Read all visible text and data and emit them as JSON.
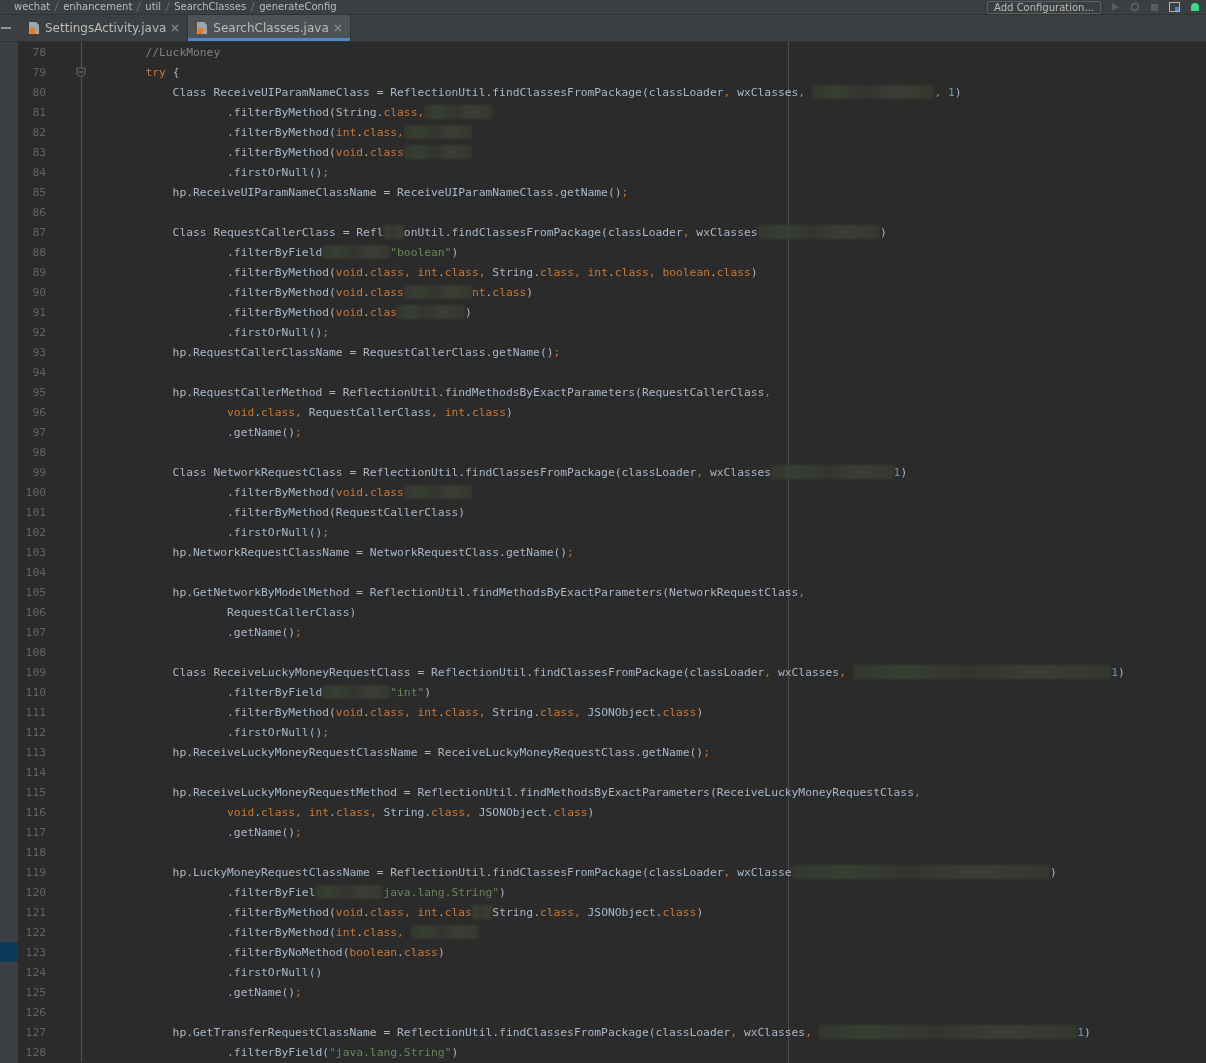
{
  "breadcrumbs": [
    "wechat",
    "enhancement",
    "util",
    "SearchClasses",
    "generateConfig"
  ],
  "run_config": "Add Configuration...",
  "tabs": [
    {
      "label": "SettingsActivity.java",
      "selected": false
    },
    {
      "label": "SearchClasses.java",
      "selected": true
    }
  ],
  "lines": [
    {
      "number": "78",
      "current": false,
      "fold": false,
      "segments": [
        {
          "kind": "comment",
          "text": "        //LuckMoney"
        }
      ]
    },
    {
      "number": "79",
      "current": false,
      "fold": true,
      "segments": [
        {
          "kind": "keyword",
          "text": "        try"
        },
        {
          "kind": "plain",
          "text": " {"
        }
      ]
    },
    {
      "number": "80",
      "current": false,
      "fold": false,
      "segments": [
        {
          "kind": "plain",
          "text": "            Class ReceiveUIParamNameClass = ReflectionUtil.findClassesFromPackage(classLoader"
        },
        {
          "kind": "keyword",
          "text": ","
        },
        {
          "kind": "plain",
          "text": " wxClasses"
        },
        {
          "kind": "keyword",
          "text": ", "
        },
        {
          "kind": "blur_long"
        },
        {
          "kind": "keyword",
          "text": ", "
        },
        {
          "kind": "number",
          "text": "1"
        },
        {
          "kind": "plain",
          "text": ")"
        }
      ]
    },
    {
      "number": "81",
      "current": false,
      "fold": false,
      "segments": [
        {
          "kind": "plain",
          "text": "                    .filterByMethod(String."
        },
        {
          "kind": "keyword",
          "text": "class,"
        },
        {
          "kind": "blur_short"
        }
      ]
    },
    {
      "number": "82",
      "current": false,
      "fold": false,
      "segments": [
        {
          "kind": "plain",
          "text": "                    .filterByMethod("
        },
        {
          "kind": "keyword",
          "text": "int"
        },
        {
          "kind": "plain",
          "text": "."
        },
        {
          "kind": "keyword",
          "text": "class,"
        },
        {
          "kind": "blur_short"
        }
      ]
    },
    {
      "number": "83",
      "current": false,
      "fold": false,
      "segments": [
        {
          "kind": "plain",
          "text": "                    .filterByMethod("
        },
        {
          "kind": "keyword",
          "text": "void"
        },
        {
          "kind": "plain",
          "text": "."
        },
        {
          "kind": "keyword",
          "text": "class"
        },
        {
          "kind": "blur_short"
        }
      ]
    },
    {
      "number": "84",
      "current": false,
      "fold": false,
      "segments": [
        {
          "kind": "plain",
          "text": "                    .firstOrNull()"
        },
        {
          "kind": "keyword",
          "text": ";"
        }
      ]
    },
    {
      "number": "85",
      "current": false,
      "fold": false,
      "segments": [
        {
          "kind": "plain",
          "text": "            hp.ReceiveUIParamNameClassName = ReceiveUIParamNameClass.getName()"
        },
        {
          "kind": "keyword",
          "text": ";"
        }
      ]
    },
    {
      "number": "86",
      "current": false,
      "fold": false
    },
    {
      "number": "87",
      "current": false,
      "fold": false,
      "segments": [
        {
          "kind": "plain",
          "text": "            Class RequestCallerClass = Refl"
        },
        {
          "kind": "blur_tiny"
        },
        {
          "kind": "plain",
          "text": "onUtil.findClassesFromPackage(classLoader"
        },
        {
          "kind": "keyword",
          "text": ","
        },
        {
          "kind": "plain",
          "text": " wxClasses"
        },
        {
          "kind": "blur_long"
        },
        {
          "kind": "plain",
          "text": ")"
        }
      ]
    },
    {
      "number": "88",
      "current": false,
      "fold": false,
      "segments": [
        {
          "kind": "plain",
          "text": "                    .filterByField"
        },
        {
          "kind": "blur_short"
        },
        {
          "kind": "string",
          "text": "\"boolean\""
        },
        {
          "kind": "plain",
          "text": ")"
        }
      ]
    },
    {
      "number": "89",
      "current": false,
      "fold": false,
      "segments": [
        {
          "kind": "plain",
          "text": "                    .filterByMethod("
        },
        {
          "kind": "keyword",
          "text": "void"
        },
        {
          "kind": "plain",
          "text": "."
        },
        {
          "kind": "keyword",
          "text": "class, int"
        },
        {
          "kind": "plain",
          "text": "."
        },
        {
          "kind": "keyword",
          "text": "class,"
        },
        {
          "kind": "plain",
          "text": " String."
        },
        {
          "kind": "keyword",
          "text": "class, int"
        },
        {
          "kind": "plain",
          "text": "."
        },
        {
          "kind": "keyword",
          "text": "class, boolean"
        },
        {
          "kind": "plain",
          "text": "."
        },
        {
          "kind": "keyword",
          "text": "class"
        },
        {
          "kind": "plain",
          "text": ")"
        }
      ]
    },
    {
      "number": "90",
      "current": false,
      "fold": false,
      "segments": [
        {
          "kind": "plain",
          "text": "                    .filterByMethod("
        },
        {
          "kind": "keyword",
          "text": "void"
        },
        {
          "kind": "plain",
          "text": "."
        },
        {
          "kind": "keyword",
          "text": "class"
        },
        {
          "kind": "blur_short"
        },
        {
          "kind": "keyword",
          "text": "nt"
        },
        {
          "kind": "plain",
          "text": "."
        },
        {
          "kind": "keyword",
          "text": "class"
        },
        {
          "kind": "plain",
          "text": ")"
        }
      ]
    },
    {
      "number": "91",
      "current": false,
      "fold": false,
      "segments": [
        {
          "kind": "plain",
          "text": "                    .filterByMethod("
        },
        {
          "kind": "keyword",
          "text": "void"
        },
        {
          "kind": "plain",
          "text": "."
        },
        {
          "kind": "keyword",
          "text": "clas"
        },
        {
          "kind": "blur_short"
        },
        {
          "kind": "plain",
          "text": ")"
        }
      ]
    },
    {
      "number": "92",
      "current": false,
      "fold": false,
      "segments": [
        {
          "kind": "plain",
          "text": "                    .firstOrNull()"
        },
        {
          "kind": "keyword",
          "text": ";"
        }
      ]
    },
    {
      "number": "93",
      "current": false,
      "fold": false,
      "segments": [
        {
          "kind": "plain",
          "text": "            hp.RequestCallerClassName = RequestCallerClass.getName()"
        },
        {
          "kind": "keyword",
          "text": ";"
        }
      ]
    },
    {
      "number": "94",
      "current": false,
      "fold": false
    },
    {
      "number": "95",
      "current": false,
      "fold": false,
      "segments": [
        {
          "kind": "plain",
          "text": "            hp.RequestCallerMethod = ReflectionUtil.findMethodsByExactParameters(RequestCallerClass"
        },
        {
          "kind": "keyword",
          "text": ","
        }
      ]
    },
    {
      "number": "96",
      "current": false,
      "fold": false,
      "segments": [
        {
          "kind": "keyword",
          "text": "                    void"
        },
        {
          "kind": "plain",
          "text": "."
        },
        {
          "kind": "keyword",
          "text": "class,"
        },
        {
          "kind": "plain",
          "text": " RequestCallerClass"
        },
        {
          "kind": "keyword",
          "text": ", int"
        },
        {
          "kind": "plain",
          "text": "."
        },
        {
          "kind": "keyword",
          "text": "class"
        },
        {
          "kind": "plain",
          "text": ")"
        }
      ]
    },
    {
      "number": "97",
      "current": false,
      "fold": false,
      "segments": [
        {
          "kind": "plain",
          "text": "                    .getName()"
        },
        {
          "kind": "keyword",
          "text": ";"
        }
      ]
    },
    {
      "number": "98",
      "current": false,
      "fold": false
    },
    {
      "number": "99",
      "current": false,
      "fold": false,
      "segments": [
        {
          "kind": "plain",
          "text": "            Class NetworkRequestClass = ReflectionUtil.findClassesFromPackage(classLoader"
        },
        {
          "kind": "keyword",
          "text": ","
        },
        {
          "kind": "plain",
          "text": " wxClasses"
        },
        {
          "kind": "blur_long"
        },
        {
          "kind": "number",
          "text": "1"
        },
        {
          "kind": "plain",
          "text": ")"
        }
      ]
    },
    {
      "number": "100",
      "current": false,
      "fold": false,
      "segments": [
        {
          "kind": "plain",
          "text": "                    .filterByMethod("
        },
        {
          "kind": "keyword",
          "text": "void"
        },
        {
          "kind": "plain",
          "text": "."
        },
        {
          "kind": "keyword",
          "text": "class"
        },
        {
          "kind": "blur_short"
        }
      ]
    },
    {
      "number": "101",
      "current": false,
      "fold": false,
      "segments": [
        {
          "kind": "plain",
          "text": "                    .filterByMethod(RequestCallerClass)"
        }
      ]
    },
    {
      "number": "102",
      "current": false,
      "fold": false,
      "segments": [
        {
          "kind": "plain",
          "text": "                    .firstOrNull()"
        },
        {
          "kind": "keyword",
          "text": ";"
        }
      ]
    },
    {
      "number": "103",
      "current": false,
      "fold": false,
      "segments": [
        {
          "kind": "plain",
          "text": "            hp.NetworkRequestClassName = NetworkRequestClass.getName()"
        },
        {
          "kind": "keyword",
          "text": ";"
        }
      ]
    },
    {
      "number": "104",
      "current": false,
      "fold": false
    },
    {
      "number": "105",
      "current": false,
      "fold": false,
      "segments": [
        {
          "kind": "plain",
          "text": "            hp.GetNetworkByModelMethod = ReflectionUtil.findMethodsByExactParameters(NetworkRequestClass"
        },
        {
          "kind": "keyword",
          "text": ","
        }
      ]
    },
    {
      "number": "106",
      "current": false,
      "fold": false,
      "segments": [
        {
          "kind": "plain",
          "text": "                    RequestCallerClass)"
        }
      ]
    },
    {
      "number": "107",
      "current": false,
      "fold": false,
      "segments": [
        {
          "kind": "plain",
          "text": "                    .getName()"
        },
        {
          "kind": "keyword",
          "text": ";"
        }
      ]
    },
    {
      "number": "108",
      "current": false,
      "fold": false
    },
    {
      "number": "109",
      "current": false,
      "fold": false,
      "segments": [
        {
          "kind": "plain",
          "text": "            Class ReceiveLuckyMoneyRequestClass = ReflectionUtil.findClassesFromPackage(classLoader"
        },
        {
          "kind": "keyword",
          "text": ","
        },
        {
          "kind": "plain",
          "text": " wxClasses"
        },
        {
          "kind": "keyword",
          "text": ", "
        },
        {
          "kind": "blur_wide"
        },
        {
          "kind": "number",
          "text": "1"
        },
        {
          "kind": "plain",
          "text": ")"
        }
      ]
    },
    {
      "number": "110",
      "current": false,
      "fold": false,
      "segments": [
        {
          "kind": "plain",
          "text": "                    .filterByField"
        },
        {
          "kind": "blur_short"
        },
        {
          "kind": "string",
          "text": "\"int\""
        },
        {
          "kind": "plain",
          "text": ")"
        }
      ]
    },
    {
      "number": "111",
      "current": false,
      "fold": false,
      "segments": [
        {
          "kind": "plain",
          "text": "                    .filterByMethod("
        },
        {
          "kind": "keyword",
          "text": "void"
        },
        {
          "kind": "plain",
          "text": "."
        },
        {
          "kind": "keyword",
          "text": "class, int"
        },
        {
          "kind": "plain",
          "text": "."
        },
        {
          "kind": "keyword",
          "text": "class,"
        },
        {
          "kind": "plain",
          "text": " String."
        },
        {
          "kind": "keyword",
          "text": "class,"
        },
        {
          "kind": "plain",
          "text": " JSONObject."
        },
        {
          "kind": "keyword",
          "text": "class"
        },
        {
          "kind": "plain",
          "text": ")"
        }
      ]
    },
    {
      "number": "112",
      "current": false,
      "fold": false,
      "segments": [
        {
          "kind": "plain",
          "text": "                    .firstOrNull()"
        },
        {
          "kind": "keyword",
          "text": ";"
        }
      ]
    },
    {
      "number": "113",
      "current": false,
      "fold": false,
      "segments": [
        {
          "kind": "plain",
          "text": "            hp.ReceiveLuckyMoneyRequestClassName = ReceiveLuckyMoneyRequestClass.getName()"
        },
        {
          "kind": "keyword",
          "text": ";"
        }
      ]
    },
    {
      "number": "114",
      "current": false,
      "fold": false
    },
    {
      "number": "115",
      "current": false,
      "fold": false,
      "segments": [
        {
          "kind": "plain",
          "text": "            hp.ReceiveLuckyMoneyRequestMethod = ReflectionUtil.findMethodsByExactParameters(ReceiveLuckyMoneyRequestClass"
        },
        {
          "kind": "keyword",
          "text": ","
        }
      ]
    },
    {
      "number": "116",
      "current": false,
      "fold": false,
      "segments": [
        {
          "kind": "keyword",
          "text": "                    void"
        },
        {
          "kind": "plain",
          "text": "."
        },
        {
          "kind": "keyword",
          "text": "class, int"
        },
        {
          "kind": "plain",
          "text": "."
        },
        {
          "kind": "keyword",
          "text": "class,"
        },
        {
          "kind": "plain",
          "text": " String."
        },
        {
          "kind": "keyword",
          "text": "class,"
        },
        {
          "kind": "plain",
          "text": " JSONObject."
        },
        {
          "kind": "keyword",
          "text": "class"
        },
        {
          "kind": "plain",
          "text": ")"
        }
      ]
    },
    {
      "number": "117",
      "current": false,
      "fold": false,
      "segments": [
        {
          "kind": "plain",
          "text": "                    .getName()"
        },
        {
          "kind": "keyword",
          "text": ";"
        }
      ]
    },
    {
      "number": "118",
      "current": false,
      "fold": false
    },
    {
      "number": "119",
      "current": false,
      "fold": false,
      "segments": [
        {
          "kind": "plain",
          "text": "            hp.LuckyMoneyRequestClassName = ReflectionUtil.findClassesFromPackage(classLoader"
        },
        {
          "kind": "keyword",
          "text": ","
        },
        {
          "kind": "plain",
          "text": " wxClasse"
        },
        {
          "kind": "blur_wide"
        },
        {
          "kind": "plain",
          "text": ")"
        }
      ]
    },
    {
      "number": "120",
      "current": false,
      "fold": false,
      "segments": [
        {
          "kind": "plain",
          "text": "                    .filterByFiel"
        },
        {
          "kind": "blur_short"
        },
        {
          "kind": "string",
          "text": "java.lang.String\""
        },
        {
          "kind": "plain",
          "text": ")"
        }
      ]
    },
    {
      "number": "121",
      "current": false,
      "fold": false,
      "segments": [
        {
          "kind": "plain",
          "text": "                    .filterByMethod("
        },
        {
          "kind": "keyword",
          "text": "void"
        },
        {
          "kind": "plain",
          "text": "."
        },
        {
          "kind": "keyword",
          "text": "class, int"
        },
        {
          "kind": "plain",
          "text": "."
        },
        {
          "kind": "keyword",
          "text": "clas"
        },
        {
          "kind": "blur_tiny"
        },
        {
          "kind": "plain",
          "text": "String."
        },
        {
          "kind": "keyword",
          "text": "class,"
        },
        {
          "kind": "plain",
          "text": " JSONObject."
        },
        {
          "kind": "keyword",
          "text": "class"
        },
        {
          "kind": "plain",
          "text": ")"
        }
      ]
    },
    {
      "number": "122",
      "current": false,
      "fold": false,
      "segments": [
        {
          "kind": "plain",
          "text": "                    .filterByMethod("
        },
        {
          "kind": "keyword",
          "text": "int"
        },
        {
          "kind": "plain",
          "text": "."
        },
        {
          "kind": "keyword",
          "text": "class, "
        },
        {
          "kind": "blur_short"
        }
      ]
    },
    {
      "number": "123",
      "current": true,
      "fold": false,
      "segments": [
        {
          "kind": "plain",
          "text": "                    .filterByNoMethod("
        },
        {
          "kind": "keyword",
          "text": "boolean"
        },
        {
          "kind": "plain",
          "text": "."
        },
        {
          "kind": "keyword",
          "text": "class"
        },
        {
          "kind": "plain",
          "text": ")"
        }
      ]
    },
    {
      "number": "124",
      "current": false,
      "fold": false,
      "segments": [
        {
          "kind": "plain",
          "text": "                    .firstOrNull()"
        }
      ]
    },
    {
      "number": "125",
      "current": false,
      "fold": false,
      "segments": [
        {
          "kind": "plain",
          "text": "                    .getName()"
        },
        {
          "kind": "keyword",
          "text": ";"
        }
      ]
    },
    {
      "number": "126",
      "current": false,
      "fold": false
    },
    {
      "number": "127",
      "current": false,
      "fold": false,
      "segments": [
        {
          "kind": "plain",
          "text": "            hp.GetTransferRequestClassName = ReflectionUtil.findClassesFromPackage(classLoader"
        },
        {
          "kind": "keyword",
          "text": ","
        },
        {
          "kind": "plain",
          "text": " wxClasses"
        },
        {
          "kind": "keyword",
          "text": ", "
        },
        {
          "kind": "blur_wide"
        },
        {
          "kind": "number",
          "text": "1"
        },
        {
          "kind": "plain",
          "text": ")"
        }
      ]
    },
    {
      "number": "128",
      "current": false,
      "fold": false,
      "segments": [
        {
          "kind": "plain",
          "text": "                    .filterByField("
        },
        {
          "kind": "string",
          "text": "\"java.lang.String\""
        },
        {
          "kind": "plain",
          "text": ")"
        }
      ]
    }
  ]
}
